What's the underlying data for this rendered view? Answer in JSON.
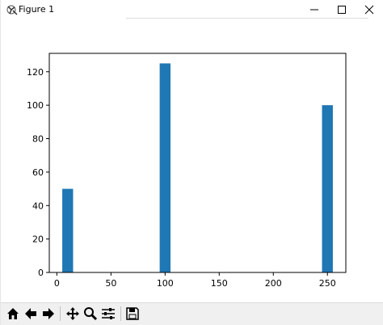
{
  "window": {
    "title": "Figure 1",
    "controls": {
      "minimize_icon": "minimize-icon",
      "maximize_icon": "maximize-icon",
      "close_icon": "close-icon"
    }
  },
  "toolbar": {
    "buttons": [
      {
        "name": "home-button",
        "icon": "home-icon"
      },
      {
        "name": "back-button",
        "icon": "arrow-left-icon"
      },
      {
        "name": "forward-button",
        "icon": "arrow-right-icon"
      },
      {
        "name": "pan-button",
        "icon": "move-icon"
      },
      {
        "name": "zoom-button",
        "icon": "magnifier-icon"
      },
      {
        "name": "configure-subplots-button",
        "icon": "sliders-icon"
      },
      {
        "name": "save-button",
        "icon": "floppy-disk-icon"
      }
    ]
  },
  "colors": {
    "bar": "#1f77b4",
    "axis": "#000000",
    "toolbar_bg": "#f0f0f0"
  },
  "chart_data": {
    "type": "bar",
    "x": [
      10,
      100,
      250
    ],
    "values": [
      50,
      125,
      100
    ],
    "bar_width": 10,
    "xlim": [
      -7,
      267
    ],
    "ylim": [
      0,
      131
    ],
    "xticks": [
      0,
      50,
      100,
      150,
      200,
      250
    ],
    "yticks": [
      0,
      20,
      40,
      60,
      80,
      100,
      120
    ],
    "grid": false,
    "title": "",
    "xlabel": "",
    "ylabel": ""
  }
}
